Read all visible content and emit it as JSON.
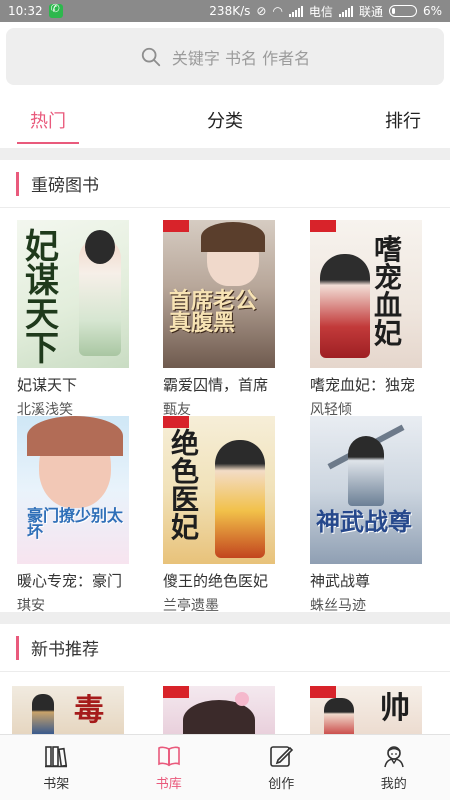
{
  "status": {
    "time": "10:32",
    "speed": "238K/s",
    "carrier1": "电信",
    "carrier2": "联通",
    "battery": "6%"
  },
  "search": {
    "placeholder": "关键字 书名 作者名"
  },
  "tabs": [
    {
      "label": "热门"
    },
    {
      "label": "分类"
    },
    {
      "label": "排行"
    }
  ],
  "sections": [
    {
      "title": "重磅图书"
    },
    {
      "title": "新书推荐"
    }
  ],
  "books": [
    {
      "title": "妃谋天下",
      "author": "北溪浅笑",
      "cover_text": "妃谋天下"
    },
    {
      "title": "霸爱囚情，首席",
      "author": "甄友",
      "cover_text": "首席老公真腹黑"
    },
    {
      "title": "嗜宠血妃：独宠",
      "author": "风轻倾",
      "cover_text": "嗜宠血妃"
    },
    {
      "title": "暖心专宠：豪门",
      "author": "琪安",
      "cover_text": "豪门撩少别太坏"
    },
    {
      "title": "傻王的绝色医妃",
      "author": "兰亭遗墨",
      "cover_text": "绝色医妃"
    },
    {
      "title": "神武战尊",
      "author": "蛛丝马迹",
      "cover_text": "神武战尊"
    }
  ],
  "new_books": [
    {
      "cover_text": "毒"
    },
    {
      "cover_text": ""
    },
    {
      "cover_text": "帅"
    }
  ],
  "nav": [
    {
      "label": "书架",
      "icon": "bookshelf-icon"
    },
    {
      "label": "书库",
      "icon": "book-library-icon"
    },
    {
      "label": "创作",
      "icon": "write-icon"
    },
    {
      "label": "我的",
      "icon": "profile-icon"
    }
  ],
  "colors": {
    "accent": "#e95a7c",
    "statusbar": "#8a8a8a",
    "band": "#eeeeee"
  }
}
